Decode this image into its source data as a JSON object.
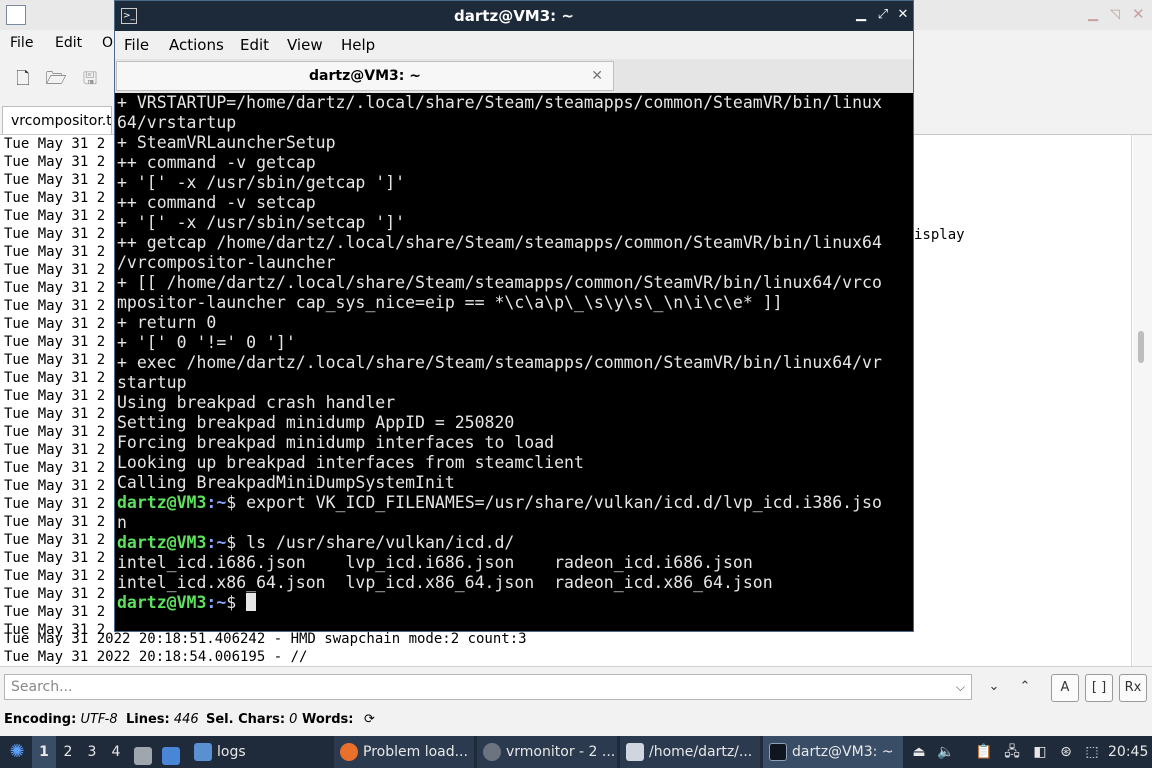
{
  "bg_window": {
    "menu": [
      "File",
      "Edit",
      "O"
    ],
    "tab_label": "vrcompositor.txt",
    "display_fragment": "isplay",
    "log_prefix": "Tue May 31 2",
    "log_lines_visible": [
      "Tue May 31 2022 20:18:51.406242 - HMD swapchain mode:2 count:3",
      "Tue May 31 2022 20:18:54.006195 - //",
      "----------------------------------------------------------------------------------------------"
    ],
    "search_placeholder": "Search...",
    "status": {
      "encoding_label": "Encoding:",
      "encoding_value": "UTF-8",
      "lines_label": "Lines:",
      "lines_value": "446",
      "sel_label": "Sel. Chars:",
      "sel_value": "0",
      "words_label": "Words:"
    },
    "search_buttons": [
      "A",
      "[ ]",
      "Rx"
    ]
  },
  "terminal": {
    "title": "dartz@VM3: ~",
    "menu": [
      "File",
      "Actions",
      "Edit",
      "View",
      "Help"
    ],
    "tab_label": "dartz@VM3: ~",
    "output_lines": [
      "+ VRSTARTUP=/home/dartz/.local/share/Steam/steamapps/common/SteamVR/bin/linux",
      "64/vrstartup",
      "+ SteamVRLauncherSetup",
      "++ command -v getcap",
      "+ '[' -x /usr/sbin/getcap ']'",
      "++ command -v setcap",
      "+ '[' -x /usr/sbin/setcap ']'",
      "++ getcap /home/dartz/.local/share/Steam/steamapps/common/SteamVR/bin/linux64",
      "/vrcompositor-launcher",
      "+ [[ /home/dartz/.local/share/Steam/steamapps/common/SteamVR/bin/linux64/vrco",
      "mpositor-launcher cap_sys_nice=eip == *\\c\\a\\p\\_\\s\\y\\s\\_\\n\\i\\c\\e* ]]",
      "+ return 0",
      "+ '[' 0 '!=' 0 ']'",
      "+ exec /home/dartz/.local/share/Steam/steamapps/common/SteamVR/bin/linux64/vr",
      "startup",
      "Using breakpad crash handler",
      "Setting breakpad minidump AppID = 250820",
      "Forcing breakpad minidump interfaces to load",
      "Looking up breakpad interfaces from steamclient",
      "Calling BreakpadMiniDumpSystemInit"
    ],
    "prompt_user": "dartz@VM3",
    "prompt_path": ":~",
    "prompt_symbol": "$ ",
    "cmd1": "export VK_ICD_FILENAMES=/usr/share/vulkan/icd.d/lvp_icd.i386.jso",
    "cmd1_wrap": "n",
    "cmd2": "ls /usr/share/vulkan/icd.d/",
    "ls_row1": "intel_icd.i686.json    lvp_icd.i686.json    radeon_icd.i686.json",
    "ls_row2": "intel_icd.x86_64.json  lvp_icd.x86_64.json  radeon_icd.x86_64.json"
  },
  "taskbar": {
    "workspaces": [
      "1",
      "2",
      "3",
      "4"
    ],
    "logs_label": "logs",
    "tasks": [
      "Problem load...",
      "vrmonitor - 2 ...",
      "/home/dartz/...",
      "dartz@VM3: ~"
    ],
    "clock": "20:45"
  }
}
